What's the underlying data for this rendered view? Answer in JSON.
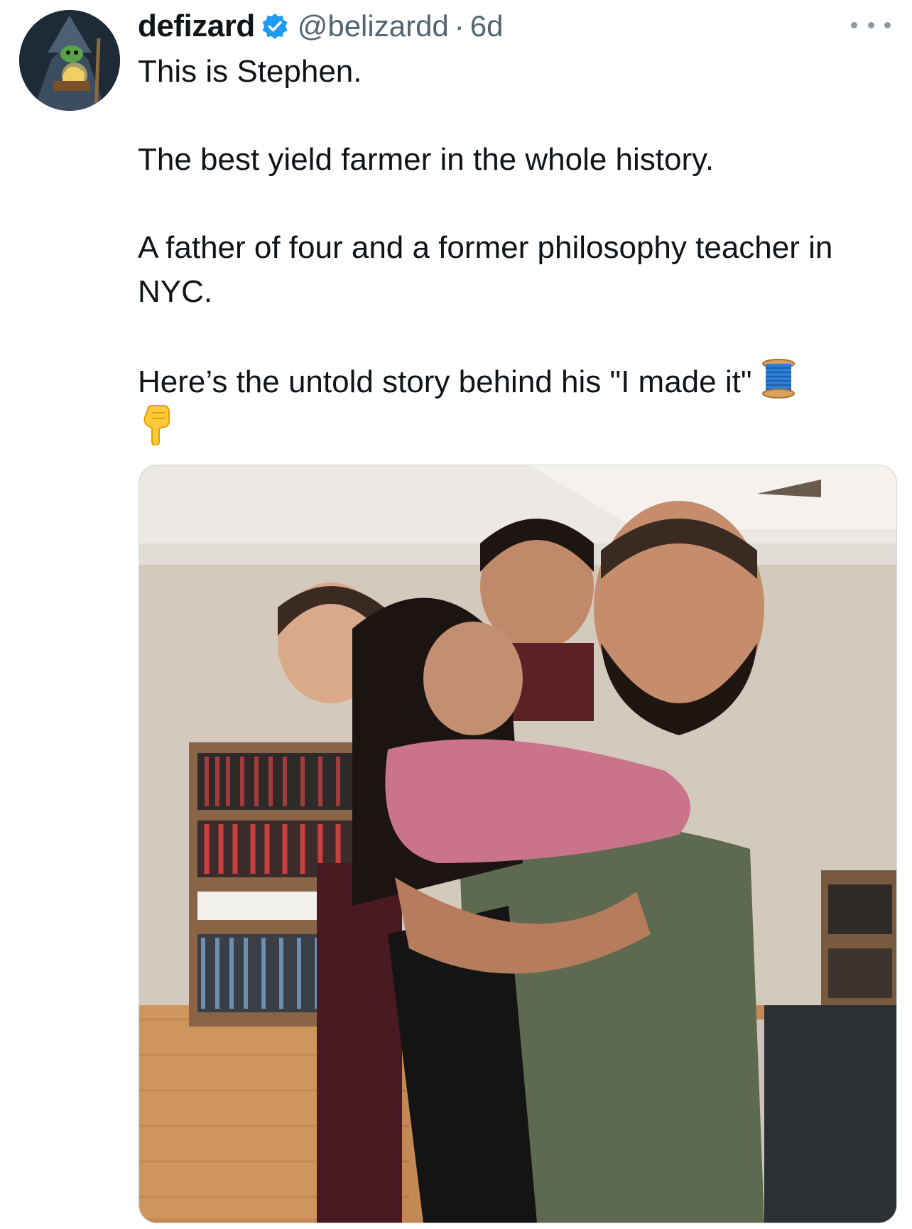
{
  "author": {
    "display_name": "defizard",
    "handle": "@belizardd",
    "separator": "·",
    "time": "6d",
    "verified": true,
    "avatar_icon": "wizard-avatar"
  },
  "tweet": {
    "lines": [
      "This is Stephen.",
      "The best yield farmer in the whole history.",
      "A father of four and a former philosophy teacher in NYC.",
      "Here’s the untold story behind his \"I made it\""
    ],
    "emojis": [
      "thread-spool-emoji",
      "pointing-down-emoji"
    ]
  },
  "media": {
    "type": "photo",
    "icon": "family-photo"
  },
  "colors": {
    "text": "#0f1419",
    "secondary": "#536471",
    "verified": "#1d9bf0",
    "border": "#cfd9de"
  }
}
